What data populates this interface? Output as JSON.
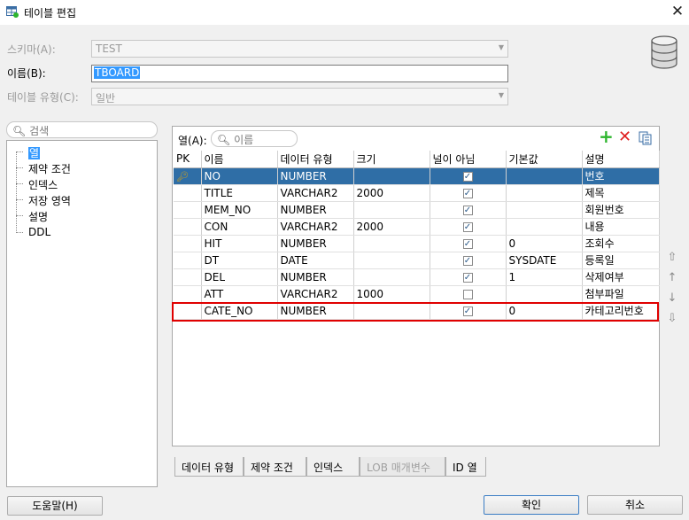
{
  "window": {
    "title": "테이블 편집",
    "close_glyph": "✕"
  },
  "form": {
    "schema_label": "스키마(A):",
    "schema_value": "TEST",
    "name_label": "이름(B):",
    "name_value": "TBOARD",
    "type_label": "테이블 유형(C):",
    "type_value": "일반"
  },
  "left": {
    "search_placeholder": "검색",
    "items": [
      "열",
      "제약 조건",
      "인덱스",
      "저장 영역",
      "설명",
      "DDL"
    ]
  },
  "columns_panel": {
    "label": "열(A):",
    "search_placeholder": "이름",
    "headers": [
      "PK",
      "이름",
      "데이터 유형",
      "크기",
      "널이 아님",
      "기본값",
      "설명"
    ],
    "rows": [
      {
        "pk": "key",
        "name": "NO",
        "type": "NUMBER",
        "size": "",
        "not_null": true,
        "default": "",
        "comment": "번호"
      },
      {
        "pk": "",
        "name": "TITLE",
        "type": "VARCHAR2",
        "size": "2000",
        "not_null": true,
        "default": "",
        "comment": "제목"
      },
      {
        "pk": "",
        "name": "MEM_NO",
        "type": "NUMBER",
        "size": "",
        "not_null": true,
        "default": "",
        "comment": "회원번호"
      },
      {
        "pk": "",
        "name": "CON",
        "type": "VARCHAR2",
        "size": "2000",
        "not_null": true,
        "default": "",
        "comment": "내용"
      },
      {
        "pk": "",
        "name": "HIT",
        "type": "NUMBER",
        "size": "",
        "not_null": true,
        "default": "0",
        "comment": "조회수"
      },
      {
        "pk": "",
        "name": "DT",
        "type": "DATE",
        "size": "",
        "not_null": true,
        "default": "SYSDATE",
        "comment": "등록일"
      },
      {
        "pk": "",
        "name": "DEL",
        "type": "NUMBER",
        "size": "",
        "not_null": true,
        "default": "1",
        "comment": "삭제여부"
      },
      {
        "pk": "",
        "name": "ATT",
        "type": "VARCHAR2",
        "size": "1000",
        "not_null": false,
        "default": "",
        "comment": "첨부파일"
      },
      {
        "pk": "",
        "name": "CATE_NO",
        "type": "NUMBER",
        "size": "",
        "not_null": true,
        "default": "0",
        "comment": "카테고리번호"
      }
    ]
  },
  "tabs": [
    "데이터 유형",
    "제약 조건",
    "인덱스",
    "LOB 매개변수",
    "ID 열"
  ],
  "buttons": {
    "help": "도움말(H)",
    "ok": "확인",
    "cancel": "취소"
  },
  "colors": {
    "selection": "#2f6ea6",
    "highlight": "#e00000",
    "add": "#2db52d",
    "delete": "#e02020"
  }
}
